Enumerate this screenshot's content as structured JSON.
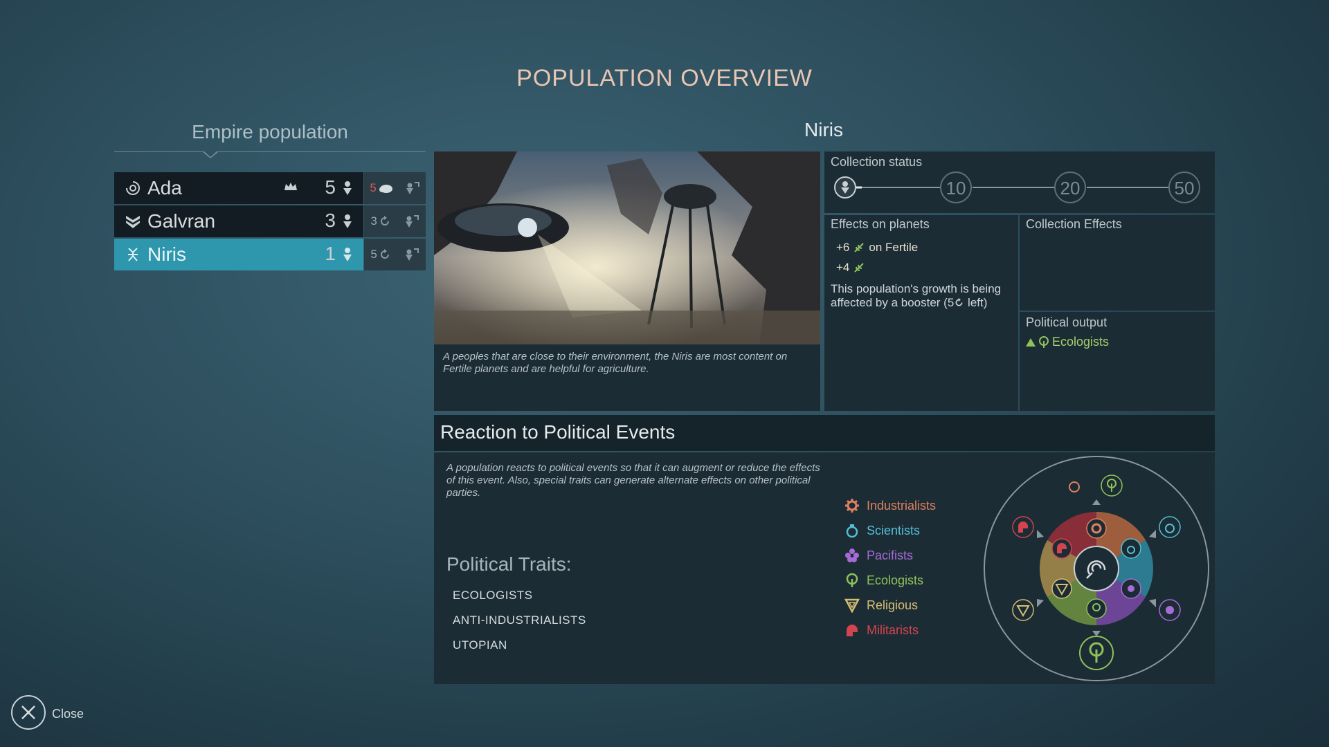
{
  "page_title": "POPULATION OVERVIEW",
  "empire": {
    "title": "Empire population",
    "rows": [
      {
        "name": "Ada",
        "count": "5",
        "side1": "5",
        "selected": false
      },
      {
        "name": "Galvran",
        "count": "3",
        "side1": "3",
        "selected": false
      },
      {
        "name": "Niris",
        "count": "1",
        "side1": "5",
        "selected": true
      }
    ]
  },
  "detail": {
    "name": "Niris",
    "description": "A peoples that are close to their environment, the Niris are most content on Fertile planets and are helpful for agriculture.",
    "collection": {
      "title": "Collection status",
      "milestones": [
        "10",
        "20",
        "50"
      ]
    },
    "effects_on_planets": {
      "title": "Effects on planets",
      "line1_value": "+6",
      "line1_suffix": "on Fertile",
      "line2_value": "+4",
      "booster_text_a": "This population's growth is being affected by a booster (5",
      "booster_text_b": " left)"
    },
    "collection_effects_title": "Collection Effects",
    "political_output": {
      "title": "Political output",
      "party": "Ecologists"
    }
  },
  "reaction": {
    "title": "Reaction to Political Events",
    "text": "A population reacts to political events so that it can augment or reduce the effects of this event. Also, special traits can generate alternate effects on other political parties.",
    "traits_title": "Political Traits:",
    "traits": [
      "ECOLOGISTS",
      "ANTI-INDUSTRIALISTS",
      "UTOPIAN"
    ],
    "legend": [
      {
        "name": "Industrialists",
        "color": "#e0815f",
        "icon": "gear-icon"
      },
      {
        "name": "Scientists",
        "color": "#54bfd6",
        "icon": "flask-icon"
      },
      {
        "name": "Pacifists",
        "color": "#a66bd6",
        "icon": "flower-icon"
      },
      {
        "name": "Ecologists",
        "color": "#8fc25a",
        "icon": "tree-icon"
      },
      {
        "name": "Religious",
        "color": "#d6bf72",
        "icon": "triangle-icon"
      },
      {
        "name": "Militarists",
        "color": "#d2444e",
        "icon": "helmet-icon"
      }
    ]
  },
  "close_label": "Close"
}
